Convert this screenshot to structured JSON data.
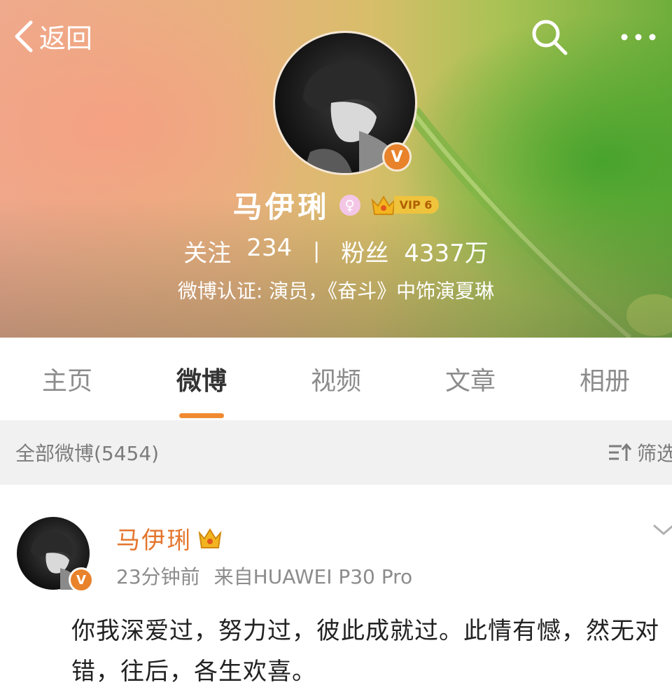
{
  "nav": {
    "back_label": "返回"
  },
  "profile": {
    "name": "马伊琍",
    "vip_label": "VIP 6",
    "verified_badge": "V",
    "follow_label": "关注",
    "follow_count": "234",
    "fans_label": "粉丝",
    "fans_count": "4337万",
    "certification": "微博认证: 演员，《奋斗》中饰演夏琳"
  },
  "tabs": [
    {
      "label": "主页"
    },
    {
      "label": "微博"
    },
    {
      "label": "视频"
    },
    {
      "label": "文章"
    },
    {
      "label": "相册"
    }
  ],
  "feed": {
    "summary": "全部微博(5454)",
    "filter_label": "筛选"
  },
  "post": {
    "author": "马伊琍",
    "time": "23分钟前",
    "source": "来自HUAWEI P30 Pro",
    "text": "你我深爱过，努力过，彼此成就过。此情有憾，然无对错，往后，各生欢喜。"
  },
  "icons": [
    "back-chevron-icon",
    "search-icon",
    "more-icon",
    "female-icon",
    "crown-icon",
    "filter-sort-icon",
    "chevron-down-icon"
  ],
  "colors": {
    "accent": "#f08a30",
    "name_orange": "#e4752c",
    "vip_gold": "#f0c33c"
  }
}
